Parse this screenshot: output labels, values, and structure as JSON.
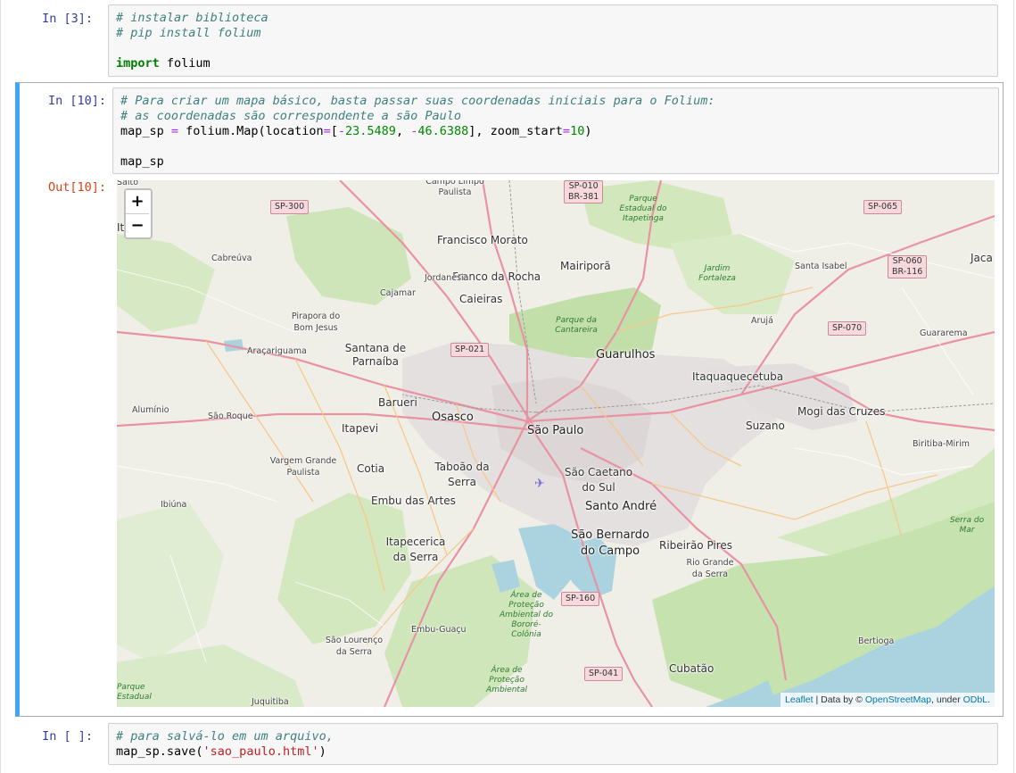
{
  "cells": [
    {
      "prompt": "In [3]:",
      "lines": [
        "# instalar biblioteca",
        "# pip install folium",
        "",
        "import folium"
      ]
    },
    {
      "prompt": "In [10]:",
      "lines": [
        "# Para criar um mapa básico, basta passar suas coordenadas iniciais para o Folium:",
        "# as coordenadas são correspondente a são Paulo",
        "map_sp = folium.Map(location=[-23.5489, -46.6388], zoom_start=10)",
        "",
        "map_sp"
      ],
      "out_prompt": "Out[10]:"
    },
    {
      "prompt": "In [ ]:",
      "lines": [
        "# para salvá-lo em um arquivo,",
        "map_sp.save('sao_paulo.html')"
      ]
    }
  ],
  "map": {
    "zoom_in": "+",
    "zoom_out": "−",
    "attribution": {
      "leaflet": "Leaflet",
      "sep": " | Data by © ",
      "osm": "OpenStreetMap",
      "under": ", under ",
      "odbl": "ODbL",
      "end": "."
    },
    "cities": {
      "sao_paulo": "São Paulo",
      "guarulhos": "Guarulhos",
      "osasco": "Osasco",
      "barueri": "Barueri",
      "francisco_morato": "Francisco Morato",
      "franco_da_rocha": "Franco da Rocha",
      "caieiras": "Caieiras",
      "mairipora": "Mairiporã",
      "santana_de_parnaiba": "Santana de Parnaíba",
      "itapevi": "Itapevi",
      "cotia": "Cotia",
      "taboao": "Taboão da Serra",
      "embu_das_artes": "Embu das Artes",
      "sao_caetano": "São Caetano do Sul",
      "santo_andre": "Santo André",
      "sao_bernardo": "São Bernardo do Campo",
      "itapecerica": "Itapecerica da Serra",
      "ribeirao_pires": "Ribeirão Pires",
      "itaquaquecetuba": "Itaquaquecetuba",
      "mogi_das_cruzes": "Mogi das Cruzes",
      "suzano": "Suzano",
      "cubatao": "Cubatão",
      "cabreuva": "Cabreúva",
      "jordanesia": "Jordanésia",
      "cajamar": "Cajamar",
      "pirapora": "Pirapora do Bom Jesus",
      "aracariguama": "Araçariguama",
      "aluminio": "Alumínio",
      "sao_roque": "São Roque",
      "vargem_grande": "Vargem Grande Paulista",
      "ibiuna": "Ibiúna",
      "santa_isabel": "Santa Isabel",
      "aruja": "Arujá",
      "guararema": "Guararema",
      "biritiba": "Biritiba-Mirim",
      "rio_grande": "Rio Grande da Serra",
      "embu_guacu": "Embu-Guaçu",
      "sao_lourenco": "São Lourenço da Serra",
      "bertioga": "Bertioga",
      "juquitiba": "Juquitiba",
      "campo_limpo": "Campo Limpo Paulista",
      "jacarei": "Jaca",
      "salto": "Salto",
      "itu": "It"
    },
    "parks": {
      "cantareira": "Parque da Cantareira",
      "itapetinga": "Parque Estadual do Itapetinga",
      "jardim_fortaleza": "Jardim Fortaleza",
      "serra_do_mar": "Serra do Mar",
      "bororé": "Área de Proteção Ambiental do Bororé-Colônia",
      "apa": "Área de Proteção Ambiental",
      "parque_estadual": "Parque Estadual"
    },
    "roads": {
      "sp300": "SP-300",
      "sp021": "SP-021",
      "sp010": "SP-010",
      "br381": "BR-381",
      "sp065": "SP-065",
      "sp060": "SP-060",
      "br116": "BR-116",
      "sp070": "SP-070",
      "sp160": "SP-160",
      "sp041": "SP-041"
    }
  }
}
